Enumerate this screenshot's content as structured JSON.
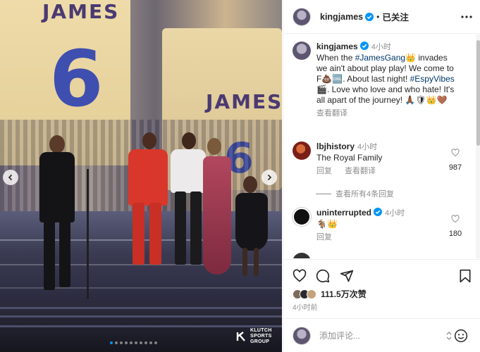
{
  "post": {
    "username": "kingjames",
    "follow_status": "已关注",
    "separator": "•"
  },
  "caption": {
    "username": "kingjames",
    "time": "4小时",
    "text_1": "When the ",
    "hashtag_1": "#JamesGang",
    "text_2": "👑 invades we ain't about play play! We come to F💩🆒. About last night! ",
    "hashtag_2": "#EspyVibes",
    "text_3": " 🎬. Love who love and who hate! It's all apart of the journey! 🙏🏾🛡👑🤎",
    "translate": "查看翻译"
  },
  "comments": [
    {
      "username": "lbjhistory",
      "time": "4小时",
      "text": "The Royal Family",
      "reply": "回复",
      "translate": "查看翻译",
      "likes": "987"
    },
    {
      "username": "uninterrupted",
      "time": "4小时",
      "text": "🐐👑",
      "reply": "回复",
      "likes": "180"
    }
  ],
  "view_replies": "查看所有4条回复",
  "likes_summary": "111.5万次赞",
  "post_time": "4小时前",
  "comment_placeholder": "添加评论...",
  "media": {
    "jersey_name": "JAMES",
    "jersey_number": "6",
    "watermark_line1": "KLUTCH",
    "watermark_line2": "SPORTS",
    "watermark_line3": "GROUP",
    "carousel_count": 10,
    "carousel_active": 1
  },
  "icons": [
    "heart-icon",
    "comment-icon",
    "share-icon",
    "bookmark-icon",
    "emoji-icon",
    "more-icon",
    "verified-icon"
  ]
}
